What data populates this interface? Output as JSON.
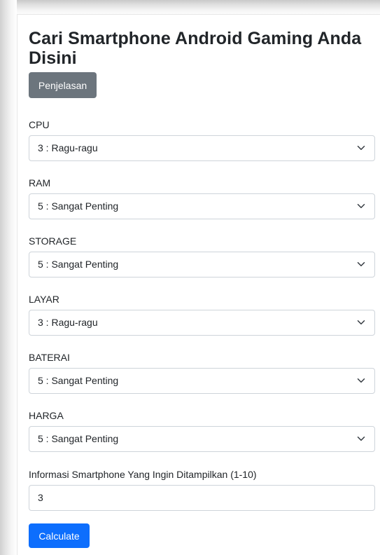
{
  "header": {
    "title": "Cari Smartphone Android Gaming Anda Disini",
    "explain_button": "Penjelasan"
  },
  "fields": [
    {
      "label": "CPU",
      "value": "3 : Ragu-ragu"
    },
    {
      "label": "RAM",
      "value": "5 : Sangat Penting"
    },
    {
      "label": "STORAGE",
      "value": "5 : Sangat Penting"
    },
    {
      "label": "LAYAR",
      "value": "3 : Ragu-ragu"
    },
    {
      "label": "BATERAI",
      "value": "5 : Sangat Penting"
    },
    {
      "label": "HARGA",
      "value": "5 : Sangat Penting"
    }
  ],
  "count_field": {
    "label": "Informasi Smartphone Yang Ingin Ditampilkan (1-10)",
    "value": "3"
  },
  "calculate_button": "Calculate",
  "colors": {
    "primary": "#0d6efd",
    "secondary": "#6c757d",
    "border": "#ced4da",
    "text": "#212529"
  },
  "icons": {
    "select_arrow": "chevron-down-icon"
  }
}
